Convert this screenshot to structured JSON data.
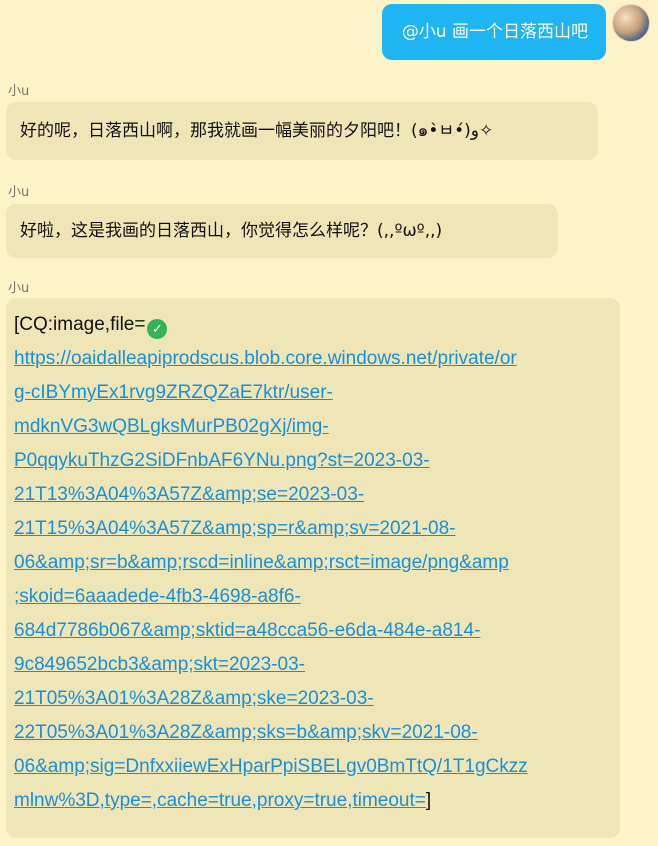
{
  "outgoing": {
    "text": "@小u 画一个日落西山吧"
  },
  "messages": [
    {
      "sender": "小u",
      "text": "好的呢，日落西山啊，那我就画一幅美丽的夕阳吧！(๑•̀ㅂ•́)و✧"
    },
    {
      "sender": "小u",
      "text": "好啦，这是我画的日落西山，你觉得怎么样呢？(,,ºωº,,)"
    },
    {
      "sender": "小u",
      "prefix": "[CQ:image,file=",
      "link_lines": [
        "https://oaidalleapiprodscus.blob.core.windows.net/private/or",
        "g-cIBYmyEx1rvg9ZRZQZaE7ktr/user-",
        "mdknVG3wQBLgksMurPB02gXj/img-",
        "P0qqykuThzG2SiDFnbAF6YNu.png?st=2023-03-",
        "21T13%3A04%3A57Z&amp;se=2023-03-",
        "21T15%3A04%3A57Z&amp;sp=r&amp;sv=2021-08-",
        "06&amp;sr=b&amp;rscd=inline&amp;rsct=image/png&amp",
        ";skoid=6aaadede-4fb3-4698-a8f6-",
        "684d7786b067&amp;sktid=a48cca56-e6da-484e-a814-",
        "9c849652bcb3&amp;skt=2023-03-",
        "21T05%3A01%3A28Z&amp;ske=2023-03-",
        "22T05%3A01%3A28Z&amp;sks=b&amp;skv=2021-08-",
        "06&amp;sig=DnfxxiiewExHparPpiSBELgv0BmTtQ/1T1gCkzz",
        "mlnw%3D,type=,cache=true,proxy=true,timeout="
      ],
      "suffix": "]"
    }
  ],
  "colors": {
    "background": "#fdf3c8",
    "outgoing_bubble": "#1fb4f2",
    "incoming_bubble": "#efe6b8",
    "link": "#1a8fd8",
    "check_icon": "#34b35a"
  },
  "icons": {
    "check": "check-shield-icon",
    "avatar": "user-avatar"
  }
}
